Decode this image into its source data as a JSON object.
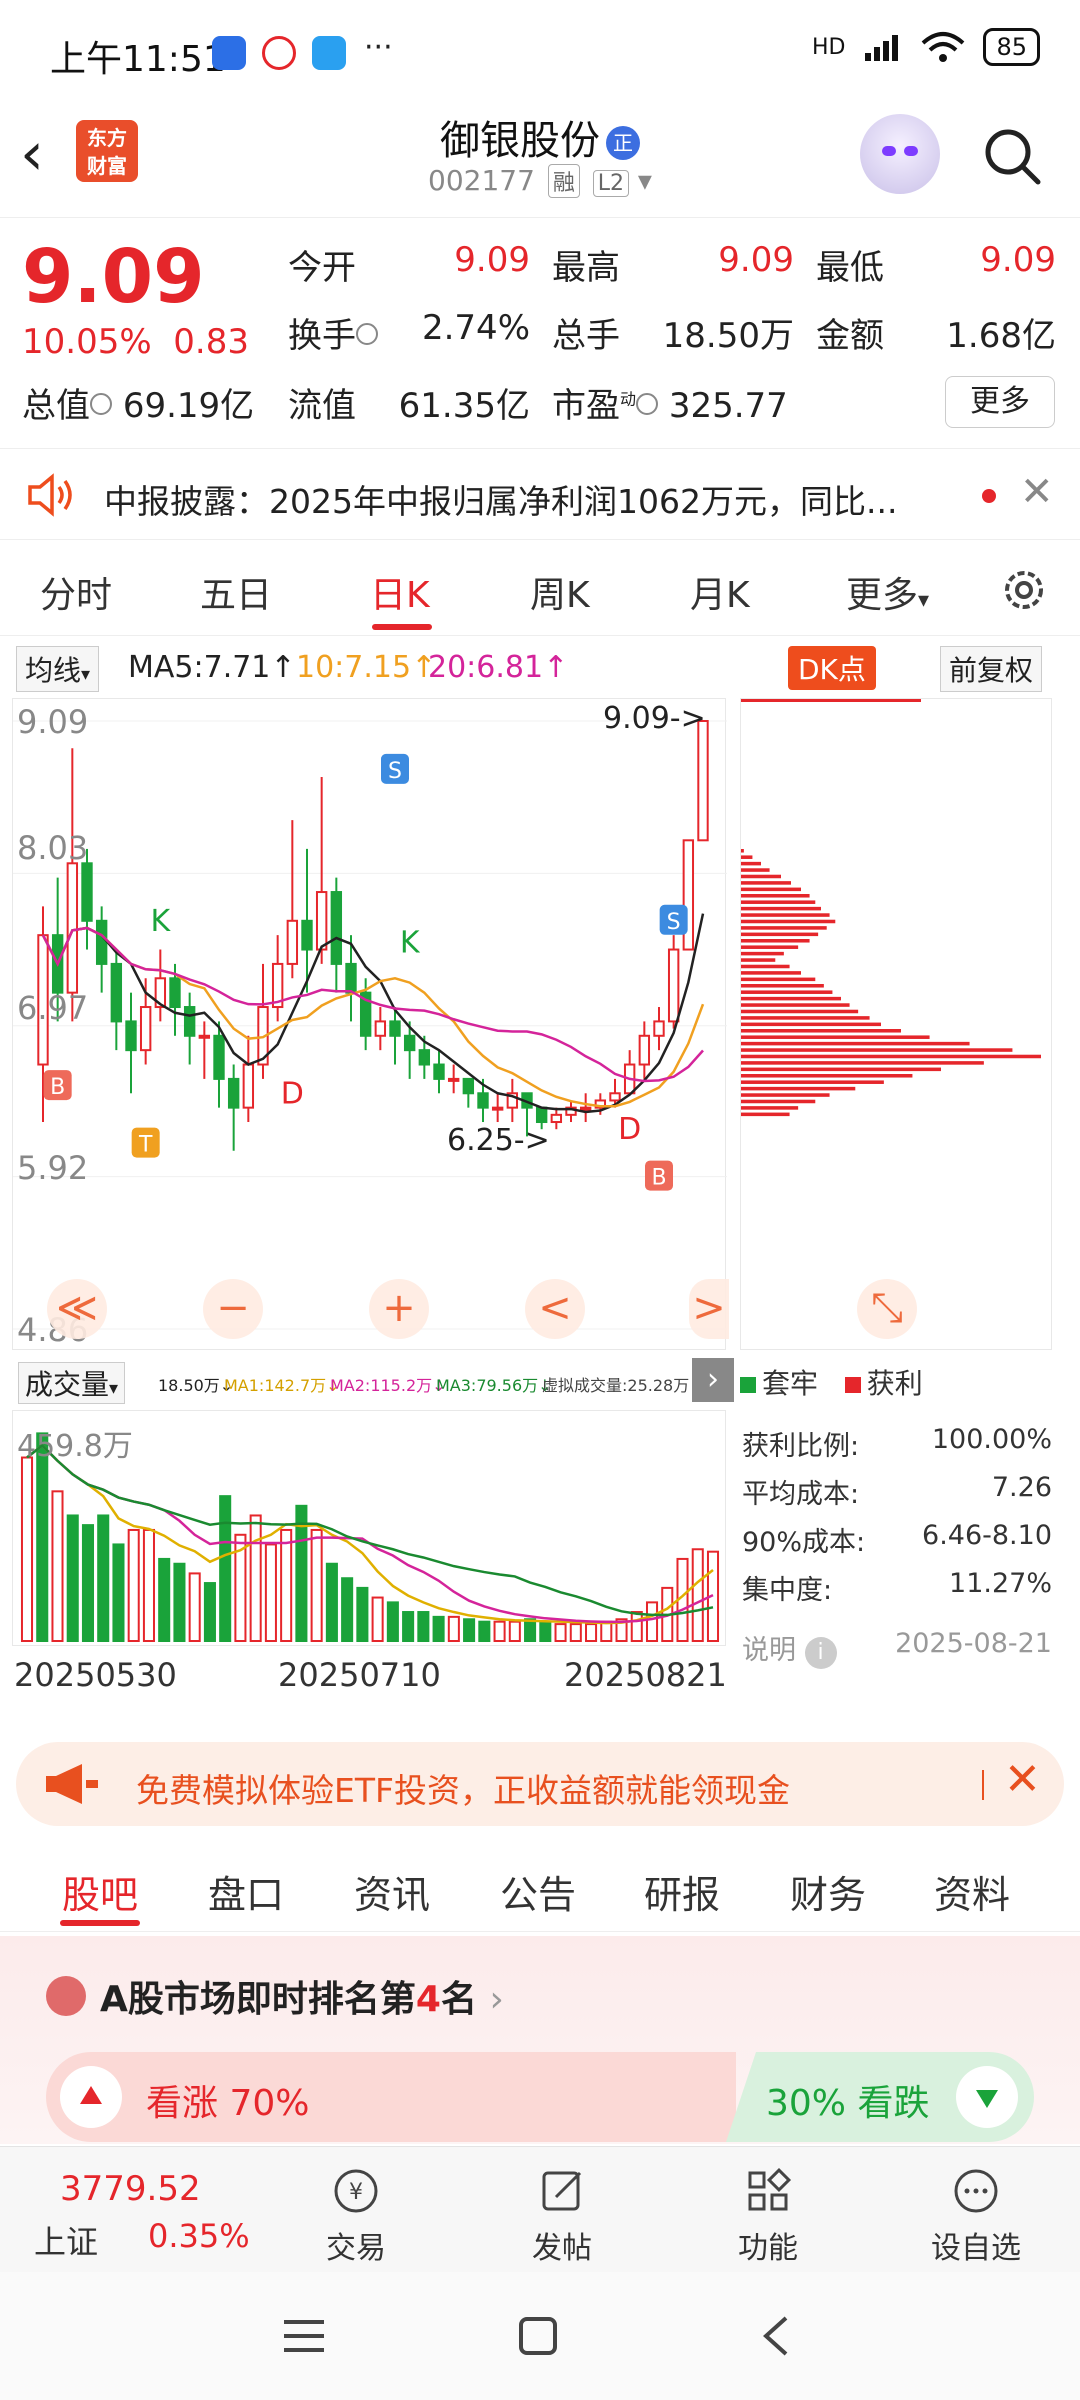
{
  "status_bar": {
    "time": "上午11:51",
    "battery": "85",
    "network": "HD"
  },
  "header": {
    "stock_name": "御银股份",
    "name_badge": "正",
    "stock_code": "002177",
    "tag_margin": "融",
    "tag_level": "L2",
    "logo_line1": "东方",
    "logo_line2": "财富"
  },
  "quote": {
    "price": "9.09",
    "change_pct": "10.05%",
    "change_amt": "0.83",
    "open_label": "今开",
    "open": "9.09",
    "high_label": "最高",
    "high": "9.09",
    "low_label": "最低",
    "low": "9.09",
    "turnover_label": "换手",
    "turnover": "2.74%",
    "volume_label": "总手",
    "volume": "18.50万",
    "amount_label": "金额",
    "amount": "1.68亿",
    "mktcap_label": "总值",
    "mktcap": "69.19亿",
    "float_label": "流值",
    "float_cap": "61.35亿",
    "pe_label": "市盈",
    "pe_sup": "动",
    "pe": "325.77",
    "more_label": "更多"
  },
  "news": {
    "text": "中报披露：2025年中报归属净利润1062万元，同比..."
  },
  "chart_tabs": [
    "分时",
    "五日",
    "日K",
    "周K",
    "月K",
    "更多"
  ],
  "ma": {
    "selector": "均线",
    "ma5": "MA5:7.71↑",
    "ma10": "10:7.15↑",
    "ma20": "20:6.81↑",
    "dk_button": "DK点",
    "adjust_button": "前复权"
  },
  "kline": {
    "y_labels": [
      "9.09",
      "8.03",
      "6.97",
      "5.92",
      "4.86"
    ],
    "high_mark": "9.09->",
    "low_mark": "6.25->",
    "signal_labels": [
      "S",
      "S",
      "B",
      "B",
      "K",
      "K",
      "T",
      "D",
      "D"
    ],
    "ctrl_labels": [
      "≪",
      "−",
      "+",
      "<",
      ">",
      "⤡"
    ]
  },
  "volume": {
    "selector": "成交量",
    "info": "18.50万↓",
    "ma1": "MA1:142.7万↓",
    "ma2": "MA2:115.2万↓",
    "ma3": "MA3:79.56万↓",
    "virtual": "虚拟成交量:25.28万",
    "max_label": "459.8万",
    "dates": [
      "20250530",
      "20250710",
      "20250821"
    ]
  },
  "chip": {
    "legend_trap": "套牢",
    "legend_profit": "获利",
    "stats": [
      {
        "label": "获利比例:",
        "value": "100.00%"
      },
      {
        "label": "平均成本:",
        "value": "7.26"
      },
      {
        "label": "90%成本:",
        "value": "6.46-8.10"
      },
      {
        "label": "集中度:",
        "value": "11.27%"
      },
      {
        "label": "说明",
        "value": "2025-08-21"
      }
    ]
  },
  "promo": {
    "text": "免费模拟体验ETF投资，正收益额就能领现金"
  },
  "bottom_tabs": [
    "股吧",
    "盘口",
    "资讯",
    "公告",
    "研报",
    "财务",
    "资料"
  ],
  "rank": {
    "title_prefix": "A股市场即时排名第",
    "rank_num": "4",
    "title_suffix": "名",
    "up_label": "看涨 70%",
    "down_label": "30% 看跌"
  },
  "bottom_nav": {
    "index_value": "3779.52",
    "index_name": "上证",
    "index_pct": "0.35%",
    "items": [
      "交易",
      "发帖",
      "功能",
      "设自选"
    ]
  },
  "colors": {
    "up": "#e5262b",
    "down": "#1aa33a",
    "ma10": "#f0a020",
    "ma20": "#d4249a",
    "accent": "#ee4d1d"
  },
  "chart_data": {
    "type": "candlestick",
    "ylim": [
      4.86,
      9.09
    ],
    "y_ticks": [
      9.09,
      8.03,
      6.97,
      5.92,
      4.86
    ],
    "candles": [
      [
        6.7,
        7.6,
        6.3,
        7.8
      ],
      [
        7.6,
        7.2,
        7.0,
        8.0
      ],
      [
        7.2,
        8.1,
        7.0,
        8.9
      ],
      [
        8.1,
        7.7,
        7.5,
        8.2
      ],
      [
        7.7,
        7.4,
        7.2,
        7.8
      ],
      [
        7.4,
        7.0,
        6.8,
        7.5
      ],
      [
        7.0,
        6.8,
        6.5,
        7.2
      ],
      [
        6.8,
        7.1,
        6.7,
        7.3
      ],
      [
        7.1,
        7.3,
        7.0,
        7.5
      ],
      [
        7.3,
        7.1,
        6.9,
        7.4
      ],
      [
        7.1,
        6.9,
        6.7,
        7.2
      ],
      [
        6.9,
        6.9,
        6.6,
        7.0
      ],
      [
        6.9,
        6.6,
        6.4,
        7.0
      ],
      [
        6.6,
        6.4,
        6.1,
        6.7
      ],
      [
        6.4,
        6.7,
        6.3,
        6.9
      ],
      [
        6.7,
        7.1,
        6.6,
        7.4
      ],
      [
        7.1,
        7.4,
        7.0,
        7.6
      ],
      [
        7.4,
        7.7,
        7.3,
        8.4
      ],
      [
        7.7,
        7.5,
        7.2,
        8.2
      ],
      [
        7.5,
        7.9,
        7.4,
        8.7
      ],
      [
        7.9,
        7.4,
        7.2,
        8.0
      ],
      [
        7.4,
        7.2,
        7.0,
        7.6
      ],
      [
        7.2,
        6.9,
        6.8,
        7.3
      ],
      [
        6.9,
        7.0,
        6.8,
        7.1
      ],
      [
        7.0,
        6.9,
        6.7,
        7.1
      ],
      [
        6.9,
        6.8,
        6.6,
        7.0
      ],
      [
        6.8,
        6.7,
        6.6,
        6.9
      ],
      [
        6.7,
        6.6,
        6.5,
        6.8
      ],
      [
        6.6,
        6.6,
        6.5,
        6.7
      ],
      [
        6.6,
        6.5,
        6.4,
        6.6
      ],
      [
        6.5,
        6.4,
        6.3,
        6.6
      ],
      [
        6.4,
        6.4,
        6.3,
        6.5
      ],
      [
        6.4,
        6.5,
        6.3,
        6.6
      ],
      [
        6.5,
        6.4,
        6.2,
        6.5
      ],
      [
        6.4,
        6.3,
        6.25,
        6.4
      ],
      [
        6.3,
        6.35,
        6.25,
        6.4
      ],
      [
        6.35,
        6.4,
        6.3,
        6.45
      ],
      [
        6.4,
        6.4,
        6.3,
        6.5
      ],
      [
        6.4,
        6.45,
        6.35,
        6.5
      ],
      [
        6.45,
        6.5,
        6.4,
        6.6
      ],
      [
        6.5,
        6.7,
        6.5,
        6.8
      ],
      [
        6.7,
        6.9,
        6.6,
        7.0
      ],
      [
        6.9,
        7.0,
        6.8,
        7.1
      ],
      [
        7.0,
        7.5,
        6.95,
        7.6
      ],
      [
        7.5,
        8.26,
        7.5,
        8.26
      ],
      [
        8.26,
        9.09,
        8.26,
        9.09
      ]
    ],
    "volume_max": 459.8,
    "volumes": [
      380,
      430,
      310,
      260,
      240,
      260,
      200,
      230,
      230,
      170,
      160,
      140,
      120,
      300,
      220,
      260,
      200,
      230,
      280,
      230,
      160,
      130,
      110,
      90,
      80,
      60,
      60,
      50,
      50,
      45,
      40,
      40,
      40,
      45,
      40,
      35,
      35,
      35,
      40,
      45,
      60,
      80,
      110,
      170,
      190,
      185
    ],
    "chip_profile": [
      2,
      8,
      14,
      20,
      28,
      35,
      42,
      48,
      52,
      56,
      62,
      66,
      60,
      54,
      48,
      40,
      30,
      24,
      34,
      42,
      52,
      58,
      64,
      70,
      76,
      82,
      90,
      98,
      112,
      132,
      160,
      190,
      210,
      170,
      140,
      120,
      100,
      80,
      62,
      52,
      40,
      34
    ]
  }
}
